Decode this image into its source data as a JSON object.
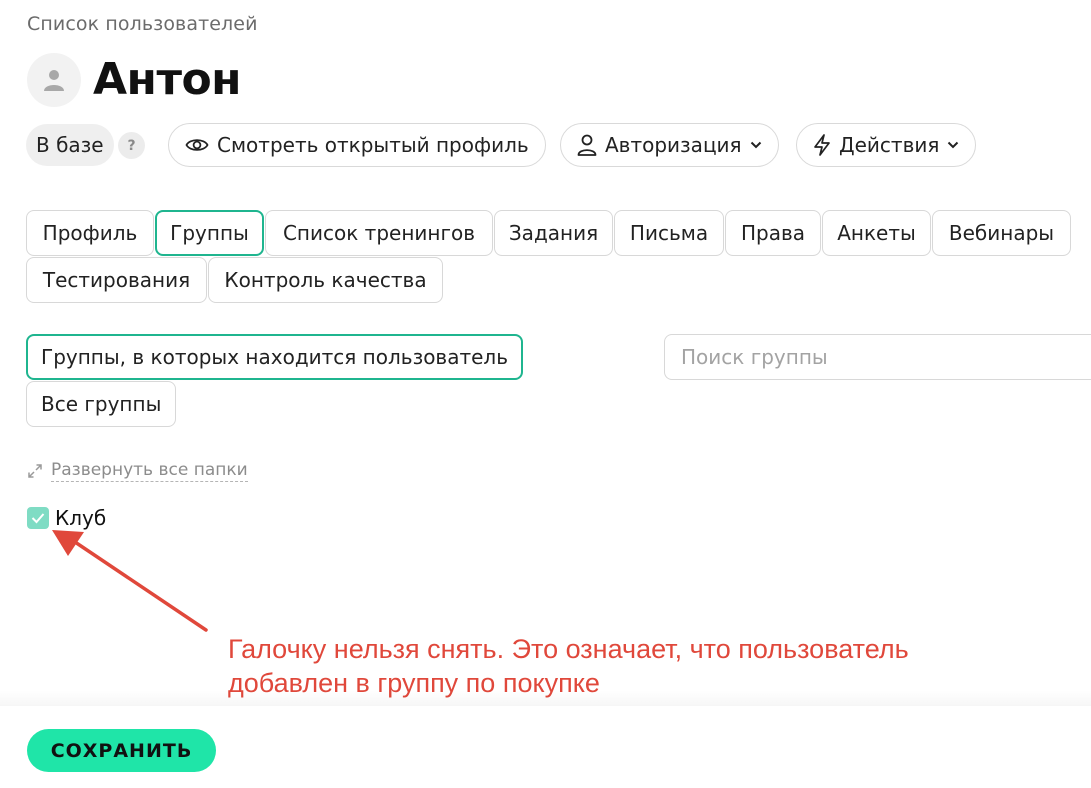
{
  "breadcrumb": "Список пользователей",
  "user": {
    "name": "Антон"
  },
  "status_badge": "В базе",
  "help": "?",
  "actions": {
    "view_profile": "Смотреть открытый профиль",
    "authorization": "Авторизация",
    "actions": "Действия"
  },
  "tabs": [
    {
      "label": "Профиль"
    },
    {
      "label": "Группы"
    },
    {
      "label": "Список тренингов"
    },
    {
      "label": "Задания"
    },
    {
      "label": "Письма"
    },
    {
      "label": "Права"
    },
    {
      "label": "Анкеты"
    },
    {
      "label": "Вебинары"
    },
    {
      "label": "Тестирования"
    },
    {
      "label": "Контроль качества"
    }
  ],
  "active_tab": "Группы",
  "filters": {
    "user_groups": "Группы, в которых находится пользователь",
    "all_groups": "Все группы"
  },
  "search": {
    "placeholder": "Поиск группы"
  },
  "expand_all": "Развернуть все папки",
  "groups": [
    {
      "label": "Клуб",
      "checked": true,
      "locked": true
    }
  ],
  "annotation": {
    "line1": "Галочку нельзя снять. Это означает, что пользователь",
    "line2": "добавлен в группу по покупке"
  },
  "save_label": "СОХРАНИТЬ",
  "colors": {
    "accent": "#1fb58f",
    "save_button": "#1fe5a8",
    "checkbox_disabled": "#7fdcc4",
    "annotation": "#e0483b"
  }
}
